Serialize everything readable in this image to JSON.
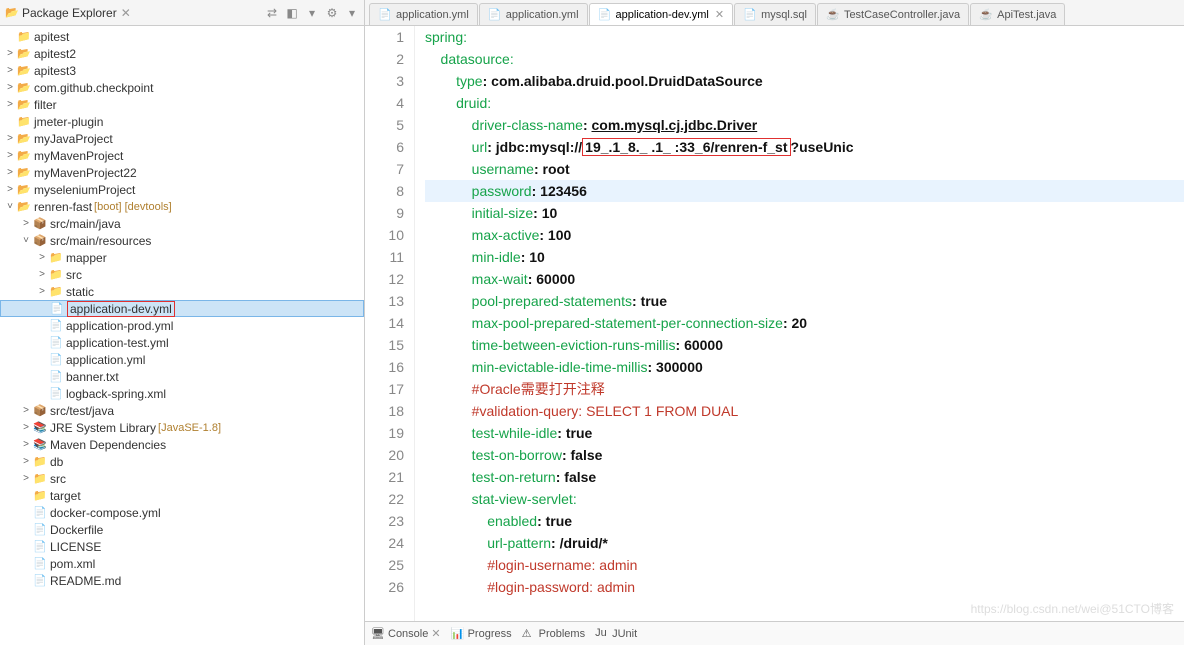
{
  "sidebar": {
    "title": "Package Explorer",
    "close": "✕",
    "tools": [
      "⇄",
      "◧",
      "▾",
      "⚙",
      "▾"
    ]
  },
  "tree": {
    "items": [
      {
        "indent": 0,
        "tw": "",
        "icon": "📁",
        "cls": "folder-blue",
        "label": "apitest"
      },
      {
        "indent": 0,
        "tw": ">",
        "icon": "📂",
        "cls": "pkg",
        "label": "apitest2"
      },
      {
        "indent": 0,
        "tw": ">",
        "icon": "📂",
        "cls": "pkg",
        "label": "apitest3"
      },
      {
        "indent": 0,
        "tw": ">",
        "icon": "📂",
        "cls": "pkg",
        "label": "com.github.checkpoint"
      },
      {
        "indent": 0,
        "tw": ">",
        "icon": "📂",
        "cls": "pkg",
        "label": "filter"
      },
      {
        "indent": 0,
        "tw": "",
        "icon": "📁",
        "cls": "folder-blue",
        "label": "jmeter-plugin"
      },
      {
        "indent": 0,
        "tw": ">",
        "icon": "📂",
        "cls": "pkg",
        "label": "myJavaProject"
      },
      {
        "indent": 0,
        "tw": ">",
        "icon": "📂",
        "cls": "pkg",
        "label": "myMavenProject"
      },
      {
        "indent": 0,
        "tw": ">",
        "icon": "📂",
        "cls": "pkg",
        "label": "myMavenProject22"
      },
      {
        "indent": 0,
        "tw": ">",
        "icon": "📂",
        "cls": "pkg",
        "label": "myseleniumProject"
      },
      {
        "indent": 0,
        "tw": "˅",
        "icon": "📂",
        "cls": "pkg",
        "label": "renren-fast",
        "dec": "[boot] [devtools]"
      },
      {
        "indent": 1,
        "tw": ">",
        "icon": "📦",
        "cls": "pkg",
        "label": "src/main/java"
      },
      {
        "indent": 1,
        "tw": "˅",
        "icon": "📦",
        "cls": "pkg",
        "label": "src/main/resources"
      },
      {
        "indent": 2,
        "tw": ">",
        "icon": "📁",
        "cls": "folder",
        "label": "mapper"
      },
      {
        "indent": 2,
        "tw": ">",
        "icon": "📁",
        "cls": "folder",
        "label": "src"
      },
      {
        "indent": 2,
        "tw": ">",
        "icon": "📁",
        "cls": "folder",
        "label": "static"
      },
      {
        "indent": 2,
        "tw": "",
        "icon": "📄",
        "cls": "yml",
        "label": "application-dev.yml",
        "boxed": true,
        "sel": true
      },
      {
        "indent": 2,
        "tw": "",
        "icon": "📄",
        "cls": "yml",
        "label": "application-prod.yml"
      },
      {
        "indent": 2,
        "tw": "",
        "icon": "📄",
        "cls": "yml",
        "label": "application-test.yml"
      },
      {
        "indent": 2,
        "tw": "",
        "icon": "📄",
        "cls": "yml",
        "label": "application.yml"
      },
      {
        "indent": 2,
        "tw": "",
        "icon": "📄",
        "cls": "yml",
        "label": "banner.txt"
      },
      {
        "indent": 2,
        "tw": "",
        "icon": "📄",
        "cls": "yml",
        "label": "logback-spring.xml"
      },
      {
        "indent": 1,
        "tw": ">",
        "icon": "📦",
        "cls": "pkg",
        "label": "src/test/java"
      },
      {
        "indent": 1,
        "tw": ">",
        "icon": "📚",
        "cls": "jar",
        "label": "JRE System Library",
        "dec": "[JavaSE-1.8]"
      },
      {
        "indent": 1,
        "tw": ">",
        "icon": "📚",
        "cls": "jar",
        "label": "Maven Dependencies"
      },
      {
        "indent": 1,
        "tw": ">",
        "icon": "📁",
        "cls": "folder",
        "label": "db"
      },
      {
        "indent": 1,
        "tw": ">",
        "icon": "📁",
        "cls": "folder",
        "label": "src"
      },
      {
        "indent": 1,
        "tw": "",
        "icon": "📁",
        "cls": "folder",
        "label": "target"
      },
      {
        "indent": 1,
        "tw": "",
        "icon": "📄",
        "cls": "yml",
        "label": "docker-compose.yml"
      },
      {
        "indent": 1,
        "tw": "",
        "icon": "📄",
        "cls": "yml",
        "label": "Dockerfile"
      },
      {
        "indent": 1,
        "tw": "",
        "icon": "📄",
        "cls": "yml",
        "label": "LICENSE"
      },
      {
        "indent": 1,
        "tw": "",
        "icon": "📄",
        "cls": "yml",
        "label": "pom.xml"
      },
      {
        "indent": 1,
        "tw": "",
        "icon": "📄",
        "cls": "yml",
        "label": "README.md"
      }
    ]
  },
  "tabs": [
    {
      "icon": "📄",
      "label": "application.yml"
    },
    {
      "icon": "📄",
      "label": "application.yml"
    },
    {
      "icon": "📄",
      "label": "application-dev.yml",
      "active": true,
      "close": "✕"
    },
    {
      "icon": "📄",
      "label": "mysql.sql"
    },
    {
      "icon": "☕",
      "label": "TestCaseController.java"
    },
    {
      "icon": "☕",
      "label": "ApiTest.java"
    }
  ],
  "code": {
    "lines": [
      {
        "n": 1,
        "seg": [
          {
            "t": "spring",
            "c": "k"
          },
          {
            "t": ":",
            "c": "k"
          }
        ]
      },
      {
        "n": 2,
        "seg": [
          {
            "t": "    datasource",
            "c": "k"
          },
          {
            "t": ":",
            "c": "k"
          }
        ]
      },
      {
        "n": 3,
        "seg": [
          {
            "t": "        type",
            "c": "k"
          },
          {
            "t": ": ",
            "c": "v"
          },
          {
            "t": "com.alibaba.druid.pool.DruidDataSource",
            "c": "v"
          }
        ]
      },
      {
        "n": 4,
        "seg": [
          {
            "t": "        druid",
            "c": "k"
          },
          {
            "t": ":",
            "c": "k"
          }
        ]
      },
      {
        "n": 5,
        "seg": [
          {
            "t": "            driver-class-name",
            "c": "k"
          },
          {
            "t": ": ",
            "c": "v"
          },
          {
            "t": "com.mysql.cj.jdbc.Driver",
            "c": "v",
            "u": true
          }
        ]
      },
      {
        "n": 6,
        "seg": [
          {
            "t": "            url",
            "c": "k"
          },
          {
            "t": ": ",
            "c": "v"
          },
          {
            "t": "jdbc:mysql://",
            "c": "v"
          },
          {
            "t": "19_.1_8._ .1_ :33_6/renren-f_st",
            "c": "v",
            "box": true
          },
          {
            "t": "?useUnic",
            "c": "v"
          }
        ]
      },
      {
        "n": 7,
        "seg": [
          {
            "t": "            username",
            "c": "k"
          },
          {
            "t": ": ",
            "c": "v"
          },
          {
            "t": "root",
            "c": "v"
          }
        ]
      },
      {
        "n": 8,
        "hl": true,
        "seg": [
          {
            "t": "            password",
            "c": "k"
          },
          {
            "t": ": ",
            "c": "v"
          },
          {
            "t": "123456",
            "c": "v"
          }
        ]
      },
      {
        "n": 9,
        "seg": [
          {
            "t": "            initial-size",
            "c": "k"
          },
          {
            "t": ": ",
            "c": "v"
          },
          {
            "t": "10",
            "c": "v"
          }
        ]
      },
      {
        "n": 10,
        "seg": [
          {
            "t": "            max-active",
            "c": "k"
          },
          {
            "t": ": ",
            "c": "v"
          },
          {
            "t": "100",
            "c": "v"
          }
        ]
      },
      {
        "n": 11,
        "seg": [
          {
            "t": "            min-idle",
            "c": "k"
          },
          {
            "t": ": ",
            "c": "v"
          },
          {
            "t": "10",
            "c": "v"
          }
        ]
      },
      {
        "n": 12,
        "seg": [
          {
            "t": "            max-wait",
            "c": "k"
          },
          {
            "t": ": ",
            "c": "v"
          },
          {
            "t": "60000",
            "c": "v"
          }
        ]
      },
      {
        "n": 13,
        "seg": [
          {
            "t": "            pool-prepared-statements",
            "c": "k"
          },
          {
            "t": ": ",
            "c": "v"
          },
          {
            "t": "true",
            "c": "v"
          }
        ]
      },
      {
        "n": 14,
        "seg": [
          {
            "t": "            max-pool-prepared-statement-per-connection-size",
            "c": "k"
          },
          {
            "t": ": ",
            "c": "v"
          },
          {
            "t": "20",
            "c": "v"
          }
        ]
      },
      {
        "n": 15,
        "seg": [
          {
            "t": "            time-between-eviction-runs-millis",
            "c": "k"
          },
          {
            "t": ": ",
            "c": "v"
          },
          {
            "t": "60000",
            "c": "v"
          }
        ]
      },
      {
        "n": 16,
        "seg": [
          {
            "t": "            min-evictable-idle-time-millis",
            "c": "k"
          },
          {
            "t": ": ",
            "c": "v"
          },
          {
            "t": "300000",
            "c": "v"
          }
        ]
      },
      {
        "n": 17,
        "seg": [
          {
            "t": "            #Oracle需要打开注释",
            "c": "c"
          }
        ]
      },
      {
        "n": 18,
        "seg": [
          {
            "t": "            #validation-query: SELECT 1 FROM DUAL",
            "c": "c"
          }
        ]
      },
      {
        "n": 19,
        "seg": [
          {
            "t": "            test-while-idle",
            "c": "k"
          },
          {
            "t": ": ",
            "c": "v"
          },
          {
            "t": "true",
            "c": "v"
          }
        ]
      },
      {
        "n": 20,
        "seg": [
          {
            "t": "            test-on-borrow",
            "c": "k"
          },
          {
            "t": ": ",
            "c": "v"
          },
          {
            "t": "false",
            "c": "v"
          }
        ]
      },
      {
        "n": 21,
        "seg": [
          {
            "t": "            test-on-return",
            "c": "k"
          },
          {
            "t": ": ",
            "c": "v"
          },
          {
            "t": "false",
            "c": "v"
          }
        ]
      },
      {
        "n": 22,
        "seg": [
          {
            "t": "            stat-view-servlet",
            "c": "k"
          },
          {
            "t": ":",
            "c": "k"
          }
        ]
      },
      {
        "n": 23,
        "seg": [
          {
            "t": "                enabled",
            "c": "k"
          },
          {
            "t": ": ",
            "c": "v"
          },
          {
            "t": "true",
            "c": "v"
          }
        ]
      },
      {
        "n": 24,
        "seg": [
          {
            "t": "                url-pattern",
            "c": "k"
          },
          {
            "t": ": ",
            "c": "v"
          },
          {
            "t": "/druid/*",
            "c": "v"
          }
        ]
      },
      {
        "n": 25,
        "seg": [
          {
            "t": "                #login-username: admin",
            "c": "c"
          }
        ]
      },
      {
        "n": 26,
        "seg": [
          {
            "t": "                #login-password: admin",
            "c": "c"
          }
        ]
      }
    ]
  },
  "bottom": {
    "tabs": [
      {
        "icon": "🖥",
        "label": "Console",
        "close": "✕"
      },
      {
        "icon": "📊",
        "label": "Progress"
      },
      {
        "icon": "⚠",
        "label": "Problems"
      },
      {
        "icon": "Ju",
        "label": "JUnit"
      }
    ]
  },
  "watermark": "https://blog.csdn.net/wei@51CTO博客"
}
